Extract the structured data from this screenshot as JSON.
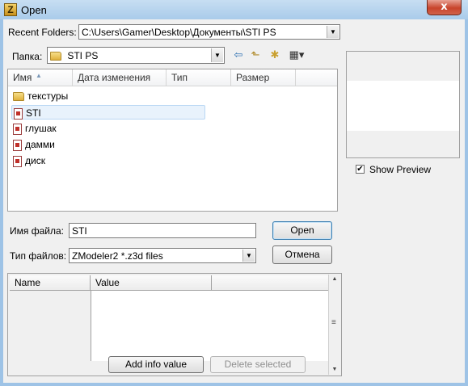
{
  "window": {
    "title": "Open",
    "close_glyph": "x",
    "app_icon_letter": "Z"
  },
  "recent_folders": {
    "label": "Recent Folders:",
    "value": "C:\\Users\\Gamer\\Desktop\\Документы\\STI PS"
  },
  "look_in": {
    "label": "Папка:",
    "value": "STI PS"
  },
  "toolbar": {
    "back": "⇦",
    "up": "⬑",
    "new_folder": "✱",
    "view": "▦▾"
  },
  "columns": [
    "Имя",
    "Дата изменения",
    "Тип",
    "Размер"
  ],
  "files": [
    {
      "name": "текстуры",
      "kind": "folder"
    },
    {
      "name": "STI",
      "kind": "file",
      "selected": true
    },
    {
      "name": "глушак",
      "kind": "file"
    },
    {
      "name": "дамми",
      "kind": "file"
    },
    {
      "name": "диск",
      "kind": "file"
    }
  ],
  "show_preview": {
    "label": "Show Preview",
    "checked": "✔"
  },
  "filename": {
    "label": "Имя файла:",
    "value": "STI"
  },
  "filetype": {
    "label": "Тип файлов:",
    "value": "ZModeler2 *.z3d files"
  },
  "buttons": {
    "open": "Open",
    "cancel": "Отмена",
    "add_info": "Add info value",
    "delete_selected": "Delete selected"
  },
  "properties": {
    "columns": [
      "Name",
      "Value"
    ]
  },
  "scroll": {
    "up": "▲",
    "down": "▼",
    "grip": "≡"
  }
}
